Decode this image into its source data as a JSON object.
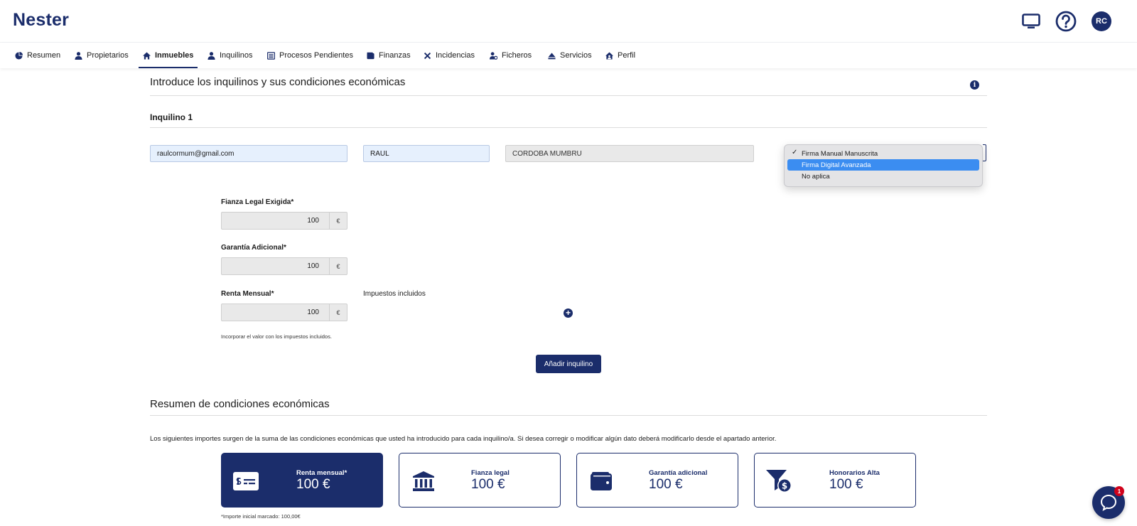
{
  "brand": "Nester",
  "user": {
    "initials": "RC"
  },
  "nav": {
    "items": [
      {
        "label": "Resumen",
        "icon": "chart-pie-icon"
      },
      {
        "label": "Propietarios",
        "icon": "user-tie-icon"
      },
      {
        "label": "Inmuebles",
        "icon": "home-icon"
      },
      {
        "label": "Inquilinos",
        "icon": "user-icon"
      },
      {
        "label": "Procesos Pendientes",
        "icon": "list-icon"
      },
      {
        "label": "Finanzas",
        "icon": "wallet-icon"
      },
      {
        "label": "Incidencias",
        "icon": "tools-icon"
      },
      {
        "label": "Ficheros",
        "icon": "user-cog-icon"
      },
      {
        "label": "Servicios",
        "icon": "eject-icon"
      },
      {
        "label": "Perfil",
        "icon": "house-user-icon"
      }
    ],
    "active": "Inmuebles"
  },
  "tenants_section": {
    "title": "Introduce los inquilinos y sus condiciones económicas",
    "tenant_title": "Inquilino 1",
    "email": "raulcormum@gmail.com",
    "name": "RAUL",
    "surname": "CORDOBA MUMBRU",
    "signature_options": [
      "Firma Manual Manuscrita",
      "Firma Digital Avanzada",
      "No aplica"
    ],
    "signature_checked": "Firma Manual Manuscrita",
    "signature_highlighted": "Firma Digital Avanzada",
    "fianza_label": "Fianza Legal Exigida*",
    "fianza_value": "100",
    "garantia_label": "Garantía Adicional*",
    "garantia_value": "100",
    "renta_label": "Renta Mensual*",
    "renta_value": "100",
    "currency": "€",
    "taxes_label": "Impuestos incluidos",
    "help": "Incorporar el valor con los impuestos incluidos.",
    "add_button": "Añadir inquilino"
  },
  "summary": {
    "title": "Resumen de condiciones económicas",
    "description": "Los siguientes importes surgen de la suma de las condiciones económicas que usted ha introducido para cada inquilino/a. Si desea corregir o modificar algún dato deberá modificarlo desde el apartado anterior.",
    "cards": [
      {
        "label": "Renta mensual*",
        "value": "100 €",
        "icon": "money-check-icon"
      },
      {
        "label": "Fianza legal",
        "value": "100 €",
        "icon": "bank-icon"
      },
      {
        "label": "Garantía adicional",
        "value": "100 €",
        "icon": "wallet-icon"
      },
      {
        "label": "Honorarios Alta",
        "value": "100 €",
        "icon": "funnel-dollar-icon"
      }
    ],
    "footnote": "*Importe inicial marcado: 100,00€"
  },
  "chat": {
    "badge": "1"
  },
  "colors": {
    "primary": "#1b2d6b",
    "select_highlight": "#3b8df1",
    "badge": "#d0021b"
  }
}
